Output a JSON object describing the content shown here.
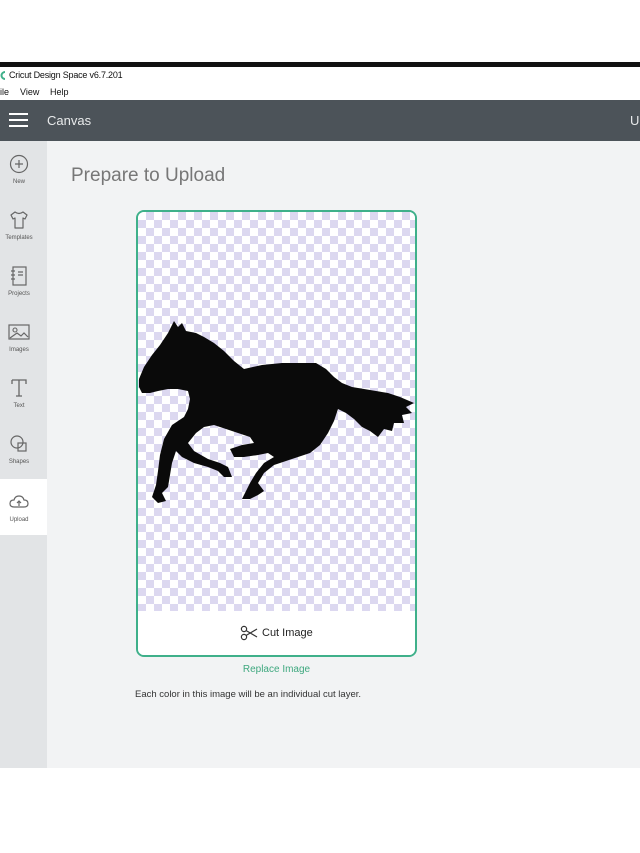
{
  "window": {
    "title": "Cricut Design Space  v6.7.201"
  },
  "menu": {
    "items": [
      "ile",
      "View",
      "Help"
    ]
  },
  "appbar": {
    "section": "Canvas",
    "right_label": "U"
  },
  "sidebar": {
    "items": [
      {
        "label": "New",
        "icon": "plus-circle-icon"
      },
      {
        "label": "Templates",
        "icon": "shirt-icon"
      },
      {
        "label": "Projects",
        "icon": "notebook-icon"
      },
      {
        "label": "Images",
        "icon": "image-icon"
      },
      {
        "label": "Text",
        "icon": "text-t-icon"
      },
      {
        "label": "Shapes",
        "icon": "shapes-icon"
      },
      {
        "label": "Upload",
        "icon": "cloud-upload-icon"
      }
    ],
    "active": "Upload"
  },
  "main": {
    "title": "Prepare to Upload",
    "preview": {
      "cut_label": "Cut Image"
    },
    "replace_label": "Replace Image",
    "note": "Each color in this image will be an individual cut layer."
  },
  "colors": {
    "accent": "#3fb08a",
    "appbar": "#4c5359",
    "sidebar": "#e2e4e6"
  }
}
